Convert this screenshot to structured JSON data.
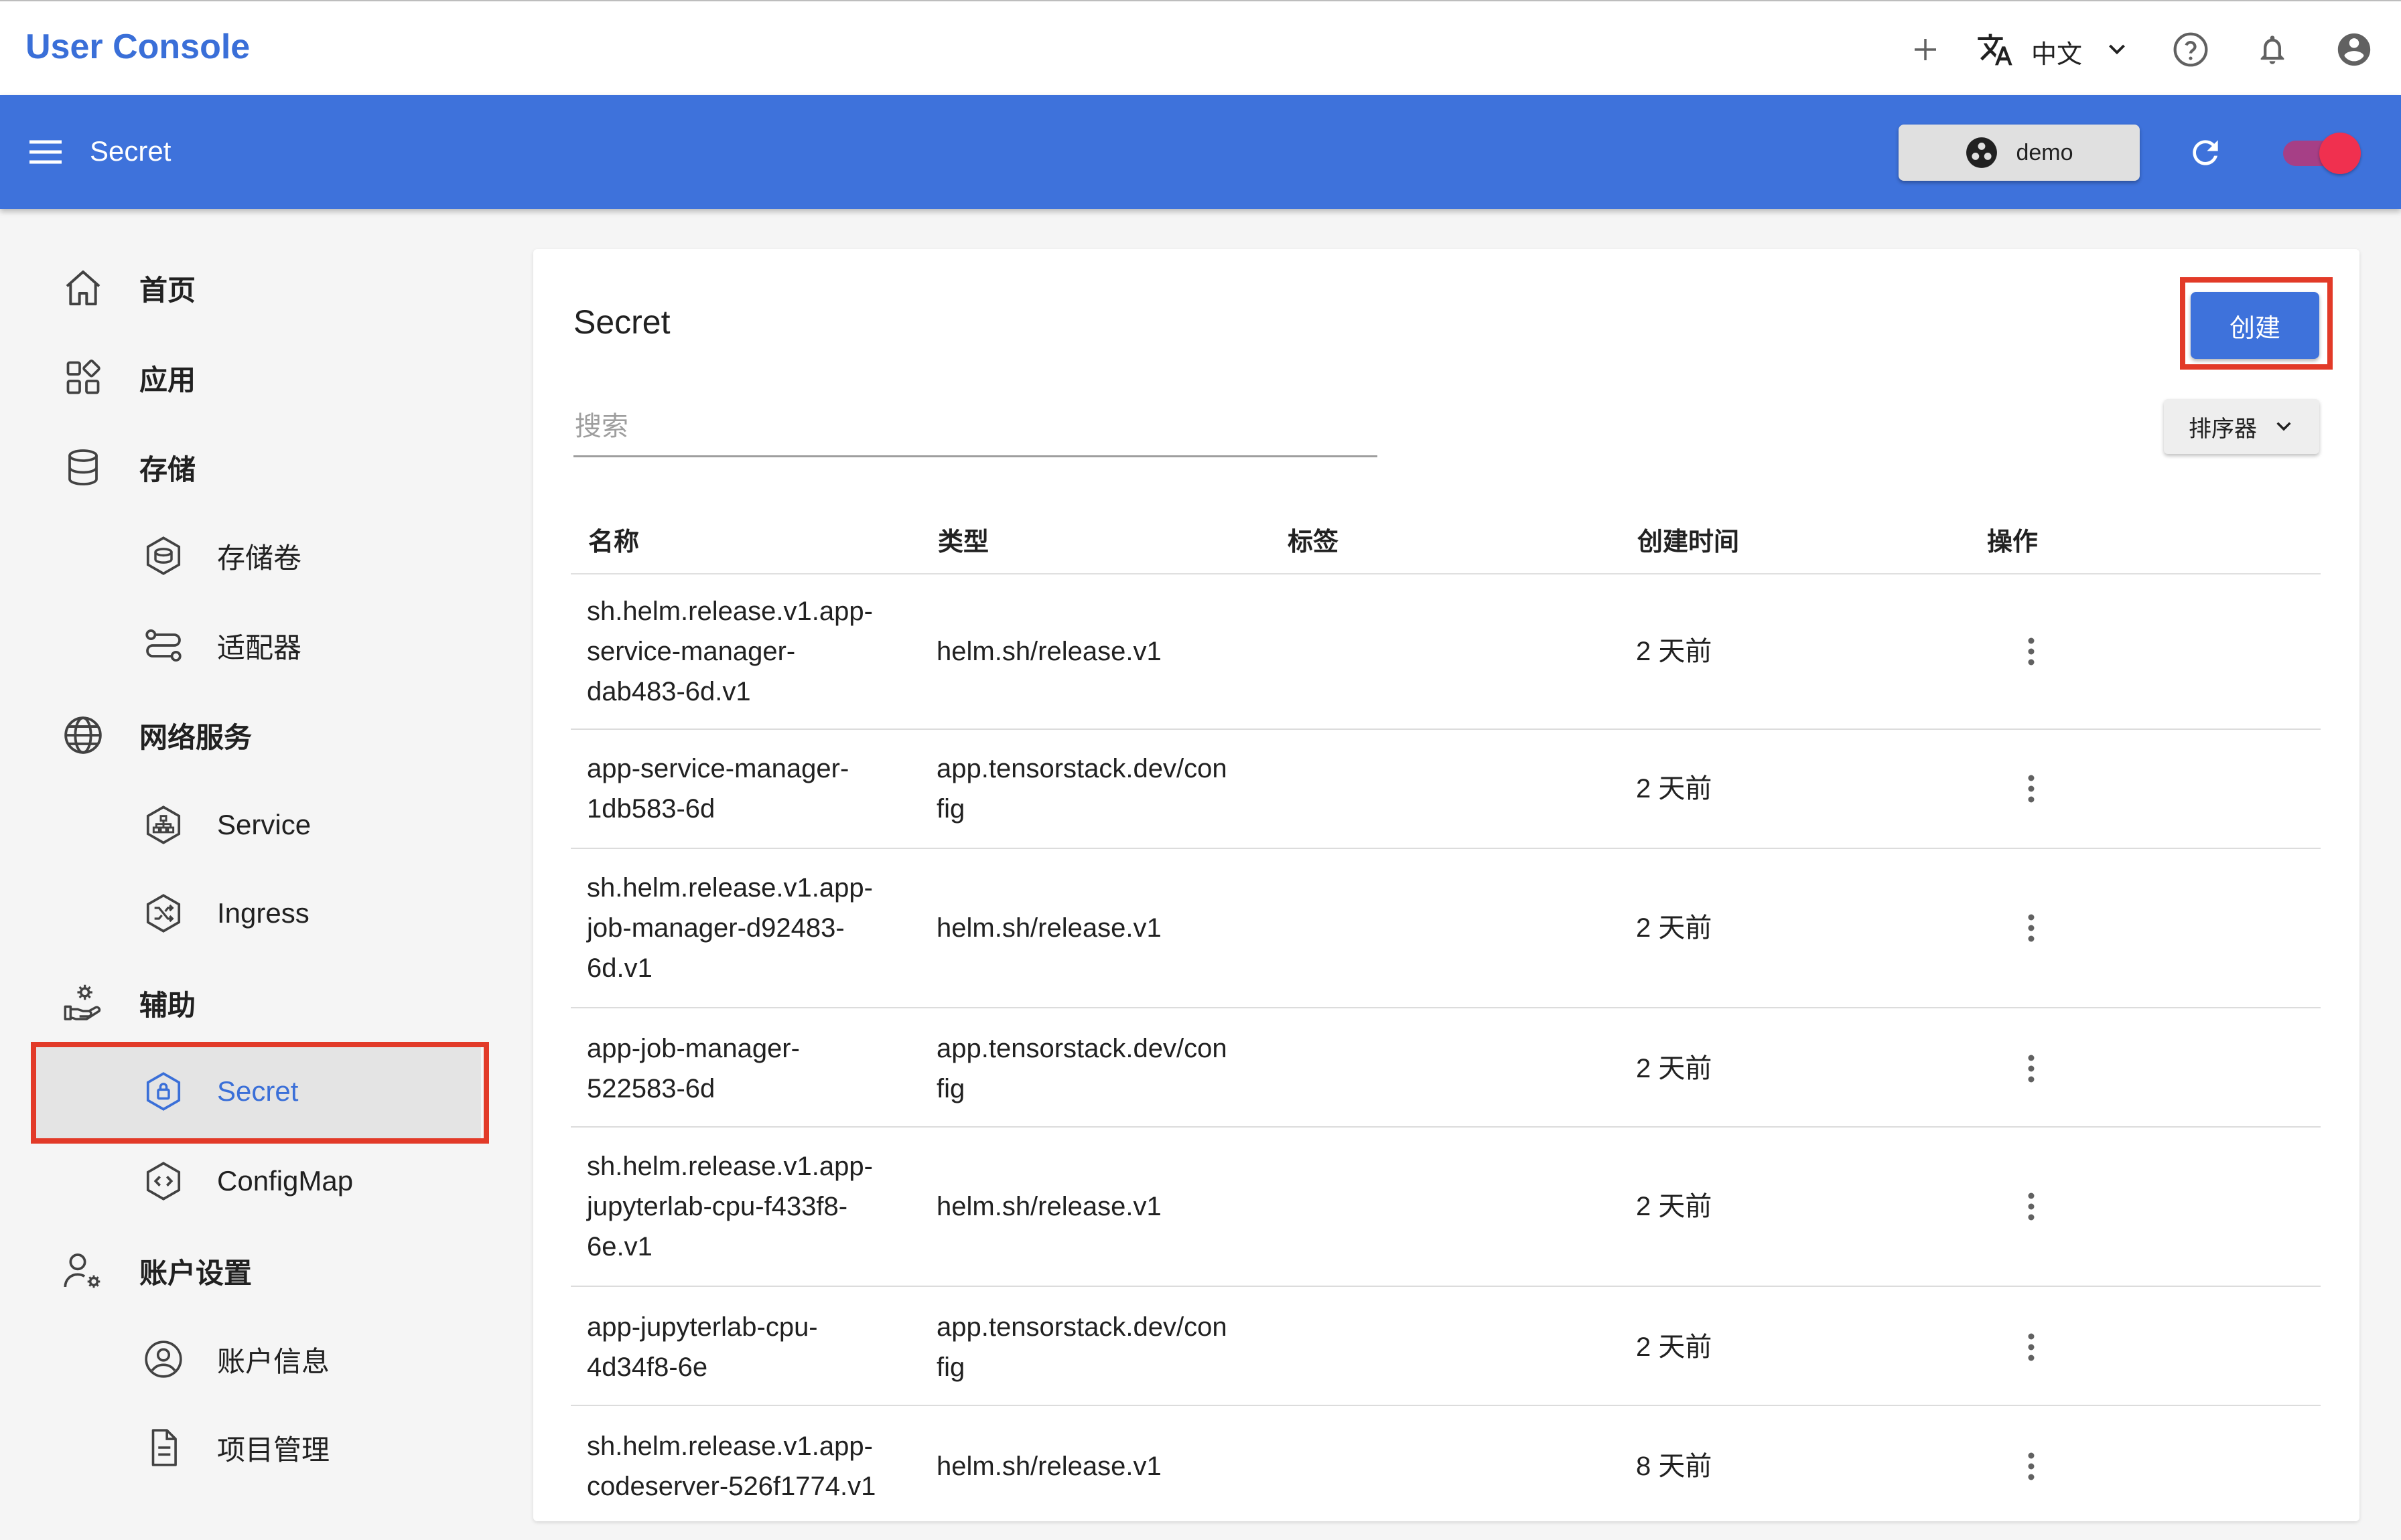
{
  "topbar": {
    "app_title": "User Console",
    "language": "中文",
    "icons": [
      "plus-icon",
      "translate-icon",
      "chevron-down-icon",
      "help-icon",
      "bell-icon",
      "account-icon"
    ]
  },
  "appbar": {
    "title": "Secret",
    "namespace": "demo",
    "toggle_on": true,
    "colors": {
      "bar": "#3e72db",
      "toggle": "#f0304f"
    }
  },
  "sidebar": {
    "items": [
      {
        "label": "首页",
        "icon": "home-icon"
      },
      {
        "label": "应用",
        "icon": "apps-icon"
      },
      {
        "label": "存储",
        "icon": "database-icon"
      },
      {
        "label": "存储卷",
        "icon": "volume-icon"
      },
      {
        "label": "适配器",
        "icon": "adapter-icon"
      },
      {
        "label": "网络服务",
        "icon": "globe-icon"
      },
      {
        "label": "Service",
        "icon": "service-icon"
      },
      {
        "label": "Ingress",
        "icon": "ingress-icon"
      },
      {
        "label": "辅助",
        "icon": "assist-icon"
      },
      {
        "label": "Secret",
        "icon": "secret-icon",
        "active": true
      },
      {
        "label": "ConfigMap",
        "icon": "configmap-icon"
      },
      {
        "label": "账户设置",
        "icon": "user-settings-icon"
      },
      {
        "label": "账户信息",
        "icon": "account-info-icon"
      },
      {
        "label": "项目管理",
        "icon": "project-icon"
      }
    ]
  },
  "main": {
    "title": "Secret",
    "create_label": "创建",
    "search_placeholder": "搜索",
    "sort_label": "排序器",
    "columns": [
      "名称",
      "类型",
      "标签",
      "创建时间",
      "操作"
    ],
    "rows": [
      {
        "name": [
          "sh.helm.release.v1.app-",
          "service-manager-",
          "dab483-6d.v1"
        ],
        "type": [
          "helm.sh/release.v1"
        ],
        "time": "2 天前"
      },
      {
        "name": [
          "app-service-manager-",
          "1db583-6d"
        ],
        "type": [
          "app.tensorstack.dev/con",
          "fig"
        ],
        "time": "2 天前"
      },
      {
        "name": [
          "sh.helm.release.v1.app-",
          "job-manager-d92483-",
          "6d.v1"
        ],
        "type": [
          "helm.sh/release.v1"
        ],
        "time": "2 天前"
      },
      {
        "name": [
          "app-job-manager-",
          "522583-6d"
        ],
        "type": [
          "app.tensorstack.dev/con",
          "fig"
        ],
        "time": "2 天前"
      },
      {
        "name": [
          "sh.helm.release.v1.app-",
          "jupyterlab-cpu-f433f8-",
          "6e.v1"
        ],
        "type": [
          "helm.sh/release.v1"
        ],
        "time": "2 天前"
      },
      {
        "name": [
          "app-jupyterlab-cpu-",
          "4d34f8-6e"
        ],
        "type": [
          "app.tensorstack.dev/con",
          "fig"
        ],
        "time": "2 天前"
      },
      {
        "name": [
          "sh.helm.release.v1.app-",
          "codeserver-526f1774.v1"
        ],
        "type": [
          "helm.sh/release.v1"
        ],
        "time": "8 天前"
      }
    ]
  }
}
